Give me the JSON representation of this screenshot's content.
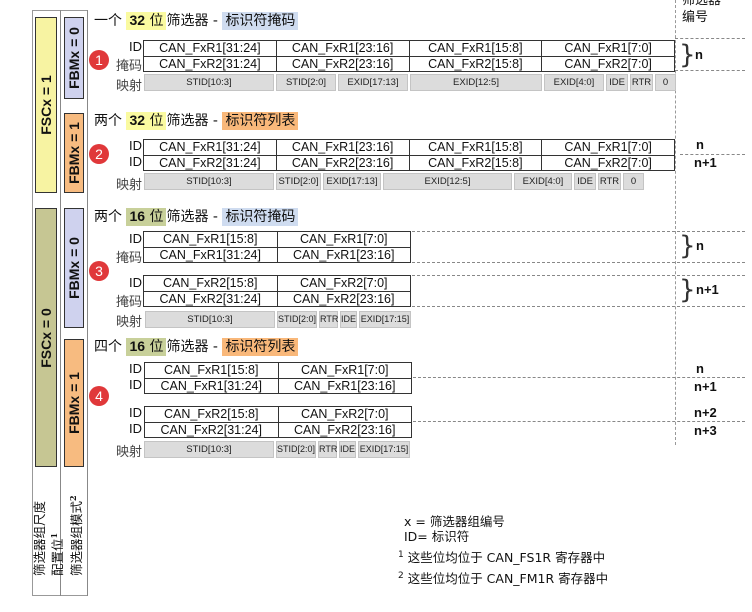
{
  "column_header": {
    "line1": "筛选器",
    "line2": "编号"
  },
  "fsc_bars": [
    {
      "label": "FSCx = 1",
      "color": "#f7f3a2"
    },
    {
      "label": "FSCx = 0",
      "color": "#c6c693"
    }
  ],
  "fbm_bars": [
    {
      "label": "FBMx = 0",
      "color": "#cfd2ee"
    },
    {
      "label": "FBMx = 1",
      "color": "#f7bb80"
    },
    {
      "label": "FBMx = 0",
      "color": "#cfd2ee"
    },
    {
      "label": "FBMx = 1",
      "color": "#f7bb80"
    }
  ],
  "sections": [
    {
      "badge": "1",
      "title": {
        "prefix": "一个 ",
        "bits": "32",
        "unit": " 位",
        "rest": "筛选器 - ",
        "mode": "标识符掩码"
      },
      "row_labels": [
        "ID",
        "掩码"
      ],
      "rows": [
        [
          "CAN_FxR1[31:24]",
          "CAN_FxR1[23:16]",
          "CAN_FxR1[15:8]",
          "CAN_FxR1[7:0]"
        ],
        [
          "CAN_FxR2[31:24]",
          "CAN_FxR2[23:16]",
          "CAN_FxR2[15:8]",
          "CAN_FxR2[7:0]"
        ]
      ],
      "map_label": "映射",
      "map": [
        "STID[10:3]",
        "STID[2:0]",
        "EXID[17:13]",
        "EXID[12:5]",
        "EXID[4:0]",
        "IDE",
        "RTR",
        "0"
      ],
      "filter_numbers": [
        "n"
      ]
    },
    {
      "badge": "2",
      "title": {
        "prefix": "两个 ",
        "bits": "32",
        "unit": " 位",
        "rest": "筛选器 - ",
        "mode": "标识符列表"
      },
      "row_labels": [
        "ID",
        "ID"
      ],
      "rows": [
        [
          "CAN_FxR1[31:24]",
          "CAN_FxR1[23:16]",
          "CAN_FxR1[15:8]",
          "CAN_FxR1[7:0]"
        ],
        [
          "CAN_FxR2[31:24]",
          "CAN_FxR2[23:16]",
          "CAN_FxR2[15:8]",
          "CAN_FxR2[7:0]"
        ]
      ],
      "map_label": "映射",
      "map": [
        "STID[10:3]",
        "STID[2:0]",
        "EXID[17:13]",
        "EXID[12:5]",
        "EXID[4:0]",
        "IDE",
        "RTR",
        "0"
      ],
      "filter_numbers": [
        "n",
        "n+1"
      ]
    },
    {
      "badge": "3",
      "title": {
        "prefix": "两个 ",
        "bits": "16",
        "unit": " 位",
        "rest": "筛选器 - ",
        "mode": "标识符掩码"
      },
      "groups": [
        {
          "row_labels": [
            "ID",
            "掩码"
          ],
          "rows": [
            [
              "CAN_FxR1[15:8]",
              "CAN_FxR1[7:0]"
            ],
            [
              "CAN_FxR1[31:24]",
              "CAN_FxR1[23:16]"
            ]
          ]
        },
        {
          "row_labels": [
            "ID",
            "掩码"
          ],
          "rows": [
            [
              "CAN_FxR2[15:8]",
              "CAN_FxR2[7:0]"
            ],
            [
              "CAN_FxR2[31:24]",
              "CAN_FxR2[23:16]"
            ]
          ]
        }
      ],
      "map_label": "映射",
      "map": [
        "STID[10:3]",
        "STID[2:0]",
        "RTR",
        "IDE",
        "EXID[17:15]"
      ],
      "filter_numbers": [
        "n",
        "n+1"
      ]
    },
    {
      "badge": "4",
      "title": {
        "prefix": "四个 ",
        "bits": "16",
        "unit": " 位",
        "rest": "筛选器 - ",
        "mode": "标识符列表"
      },
      "groups": [
        {
          "row_labels": [
            "ID",
            "ID"
          ],
          "rows": [
            [
              "CAN_FxR1[15:8]",
              "CAN_FxR1[7:0]"
            ],
            [
              "CAN_FxR1[31:24]",
              "CAN_FxR1[23:16]"
            ]
          ]
        },
        {
          "row_labels": [
            "ID",
            "ID"
          ],
          "rows": [
            [
              "CAN_FxR2[15:8]",
              "CAN_FxR2[7:0]"
            ],
            [
              "CAN_FxR2[31:24]",
              "CAN_FxR2[23:16]"
            ]
          ]
        }
      ],
      "map_label": "映射",
      "map": [
        "STID[10:3]",
        "STID[2:0]",
        "RTR",
        "IDE",
        "EXID[17:15]"
      ],
      "filter_numbers": [
        "n",
        "n+1",
        "n+2",
        "n+3"
      ]
    }
  ],
  "bottom_labels": {
    "scale_line1": "筛选器组尺度",
    "scale_line2": "配置位",
    "scale_sup": "1",
    "mode": "筛选器组模式",
    "mode_sup": "2"
  },
  "legend": {
    "x_def": "x = 筛选器组编号",
    "id_def": "ID= 标识符",
    "note1_sup": "1",
    "note1": " 这些位均位于 CAN_FS1R 寄存器中",
    "note2_sup": "2",
    "note2": " 这些位均位于 CAN_FM1R 寄存器中"
  }
}
